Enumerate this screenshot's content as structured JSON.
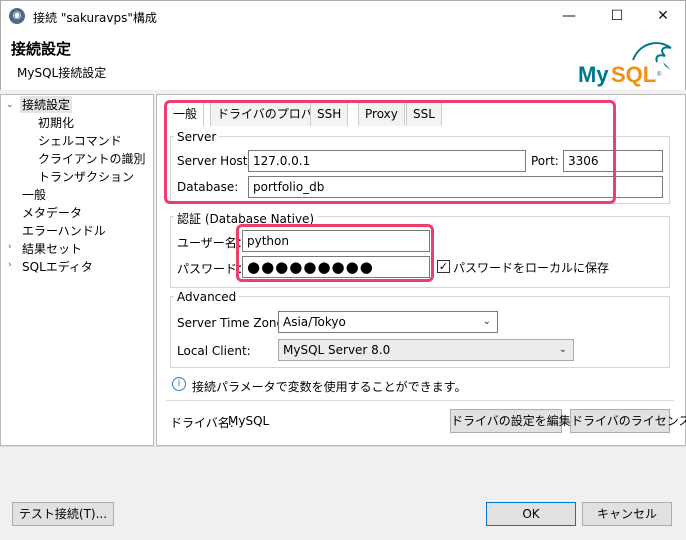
{
  "window": {
    "title": "接続 \"sakuravps\"構成",
    "minimize_glyph": "—",
    "maximize_glyph": "☐",
    "close_glyph": "✕",
    "app_icon": "dbeaver-icon"
  },
  "header": {
    "title": "接続設定",
    "subtitle": "MySQL接続設定",
    "logo_text": "MySQL",
    "logo_color": "#00758f",
    "logo_accent": "#f29111"
  },
  "tree": {
    "items": [
      {
        "label": "接続設定",
        "expanded": true,
        "selected": true
      },
      {
        "label": "初期化"
      },
      {
        "label": "シェルコマンド"
      },
      {
        "label": "クライアントの識別"
      },
      {
        "label": "トランザクション"
      },
      {
        "label": "一般"
      },
      {
        "label": "メタデータ"
      },
      {
        "label": "エラーハンドル"
      },
      {
        "label": "結果セット",
        "collapsed": true
      },
      {
        "label": "SQLエディタ",
        "collapsed": true
      }
    ]
  },
  "tabs": [
    "一般",
    "ドライバのプロパティ",
    "SSH",
    "Proxy",
    "SSL"
  ],
  "server": {
    "group_label": "Server",
    "host_label": "Server Host:",
    "host_value": "127.0.0.1",
    "port_label": "Port:",
    "port_value": "3306",
    "database_label": "Database:",
    "database_value": "portfolio_db"
  },
  "auth": {
    "group_label": "認証 (Database Native)",
    "user_label": "ユーザー名：",
    "user_value": "python",
    "password_label": "パスワード：",
    "password_value": "●●●●●●●●●",
    "save_password_label": "パスワードをローカルに保存",
    "save_password_checked": "✓"
  },
  "advanced": {
    "group_label": "Advanced",
    "timezone_label": "Server Time Zone:",
    "timezone_value": "Asia/Tokyo",
    "client_label": "Local Client:",
    "client_value": "MySQL Server 8.0"
  },
  "info": {
    "icon": "info-icon",
    "text": "接続パラメータで変数を使用することができます。"
  },
  "driver": {
    "label": "ドライバ名:",
    "name": "MySQL",
    "edit_button": "ドライバの設定を編集",
    "license_button": "ドライバのライセンス"
  },
  "footer": {
    "test_button": "テスト接続(T)...",
    "ok_button": "OK",
    "cancel_button": "キャンセル"
  },
  "highlight_color": "#ef3d6e"
}
